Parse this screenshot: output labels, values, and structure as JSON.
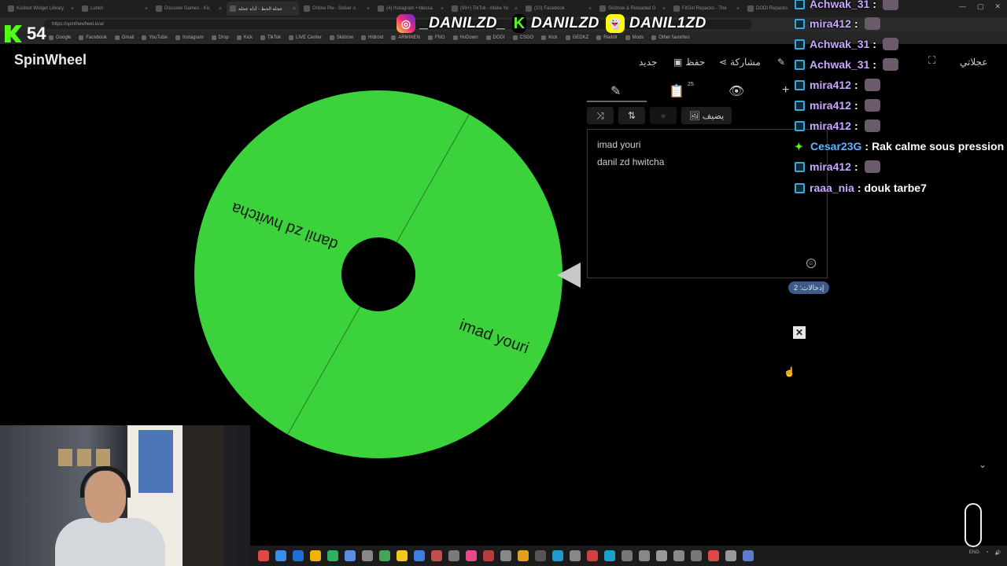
{
  "browser": {
    "tabs": [
      {
        "title": "Kickbot Widget Library"
      },
      {
        "title": "Lunkit"
      },
      {
        "title": "Discover Games - Kic"
      },
      {
        "title": "عجلة الحظ - أداة عجلة",
        "active": true
      },
      {
        "title": "Online Pie - Solver o"
      },
      {
        "title": "(4) Instagram • Messa"
      },
      {
        "title": "(99+) TikTok - Make Yo"
      },
      {
        "title": "(10) Facebook"
      },
      {
        "title": "Skidrow & Reloaded G"
      },
      {
        "title": "FitGirl Repacks - The"
      },
      {
        "title": "DODI Repacks"
      }
    ],
    "url": "https://spinthewheel.io/ar",
    "bookmarks": [
      "Google",
      "Facebook",
      "Gmail",
      "YouTube",
      "Instagram",
      "Drop",
      "Kick",
      "TikTok",
      "LIVE Center",
      "Skidrow",
      "Hidroid",
      "ARMINEN",
      "FNG",
      "HoDown",
      "DODI",
      "CSGO",
      "Kick",
      "GEDKZ",
      "Reddit",
      "Mods",
      "Other favorites"
    ]
  },
  "overlay": {
    "viewer_count": "54",
    "socials": [
      {
        "platform": "instagram",
        "icon": "instagram-icon",
        "handle": "_DANILZD_"
      },
      {
        "platform": "kick",
        "icon": "kick-icon",
        "handle": "DANILZD"
      },
      {
        "platform": "snapchat",
        "icon": "snapchat-icon",
        "handle": "DANIL1ZD"
      }
    ]
  },
  "app": {
    "brand": "SpinWheel",
    "header_buttons": {
      "new": "جديد",
      "save": "حفظ",
      "share": "مشاركة",
      "mine": "عجلاتي"
    }
  },
  "editor": {
    "clipboard_badge": "25",
    "add_image_label": "يضيف",
    "entries": [
      "imad youri",
      "danil zd hwitcha"
    ],
    "entries_count_label": "إدخالات: 2"
  },
  "wheel": {
    "segments": [
      {
        "label": "danil zd hwitcha",
        "color": "#3bd23b"
      },
      {
        "label": "imad youri",
        "color": "#3bd23b"
      }
    ],
    "accent": "#3bd23b"
  },
  "chat": [
    {
      "user": "Achwak_31",
      "msg": "",
      "emote": true,
      "badge": "sub"
    },
    {
      "user": "mira412",
      "msg": "",
      "emote": true,
      "badge": "sub"
    },
    {
      "user": "Achwak_31",
      "msg": "",
      "emote": true,
      "badge": "sub"
    },
    {
      "user": "Achwak_31",
      "msg": "",
      "emote": true,
      "badge": "sub"
    },
    {
      "user": "mira412",
      "msg": "",
      "emote": true,
      "badge": "sub"
    },
    {
      "user": "mira412",
      "msg": "",
      "emote": true,
      "badge": "sub"
    },
    {
      "user": "mira412",
      "msg": "",
      "emote": true,
      "badge": "sub"
    },
    {
      "user": "Cesar23G",
      "msg": "Rak calme sous pression",
      "emote": false,
      "badge": "verified"
    },
    {
      "user": "mira412",
      "msg": "",
      "emote": true,
      "badge": "sub"
    },
    {
      "user": "raaa_nia",
      "msg": "douk tarbe7",
      "emote": false,
      "badge": "sub"
    }
  ]
}
